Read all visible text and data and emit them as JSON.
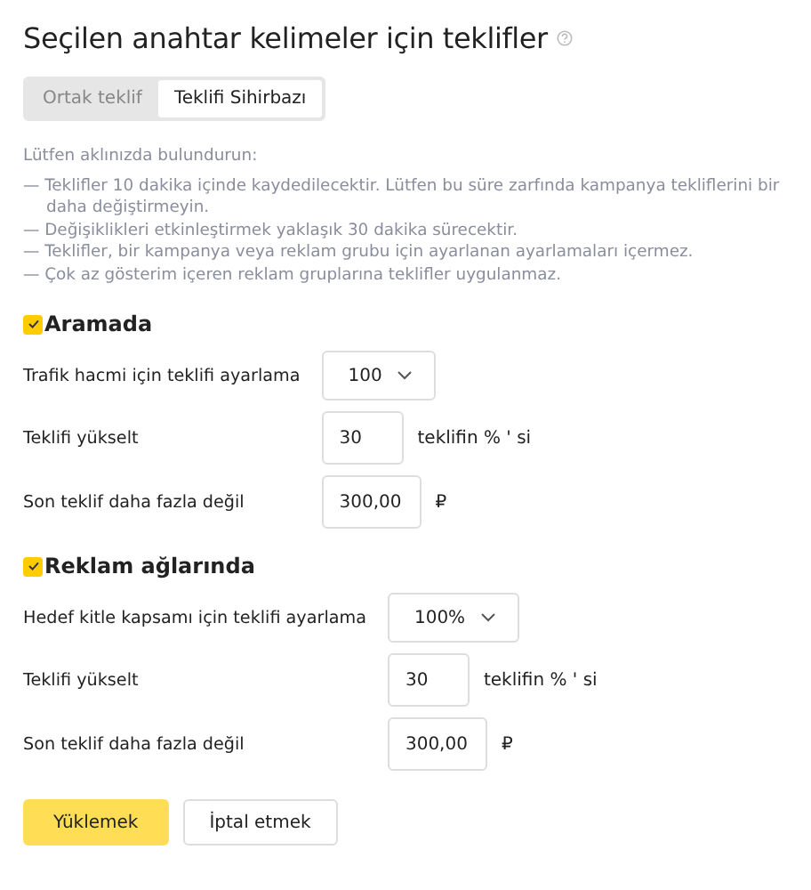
{
  "title": "Seçilen anahtar kelimeler için teklifler",
  "tabs": [
    {
      "label": "Ortak teklif",
      "selected": false
    },
    {
      "label": "Teklifi Sihirbazı",
      "selected": true
    }
  ],
  "notes": {
    "heading": "Lütfen aklınızda bulundurun:",
    "items": [
      "— Teklifler 10 dakika içinde kaydedilecektir. Lütfen bu süre zarfında kampanya tekliflerini bir daha değiştirmeyin.",
      "— Değişiklikleri etkinleştirmek yaklaşık 30 dakika sürecektir.",
      "— Teklifler, bir kampanya veya reklam grubu için ayarlanan ayarlamaları içermez.",
      "— Çok az gösterim içeren reklam gruplarına teklifler uygulanmaz."
    ]
  },
  "sections": [
    {
      "label": "Aramada",
      "checked": true,
      "rows": [
        {
          "kind": "select",
          "label": "Trafik hacmi için teklifi ayarlama",
          "value": "100"
        },
        {
          "kind": "input",
          "label": "Teklifi yükselt",
          "value": "30",
          "suffix": "teklifin % ' si"
        },
        {
          "kind": "input",
          "label": "Son teklif daha fazla değil",
          "value": "300,00",
          "suffix": "₽"
        }
      ]
    },
    {
      "label": "Reklam ağlarında",
      "checked": true,
      "rows": [
        {
          "kind": "select",
          "label": "Hedef kitle kapsamı için teklifi ayarlama",
          "value": "100%"
        },
        {
          "kind": "input",
          "label": "Teklifi yükselt",
          "value": "30",
          "suffix": "teklifin % ' si"
        },
        {
          "kind": "input",
          "label": "Son teklif daha fazla değil",
          "value": "300,00",
          "suffix": "₽"
        }
      ]
    }
  ],
  "buttons": [
    {
      "label": "Yüklemek",
      "kind": "primary"
    },
    {
      "label": "İptal etmek",
      "kind": "secondary"
    }
  ]
}
